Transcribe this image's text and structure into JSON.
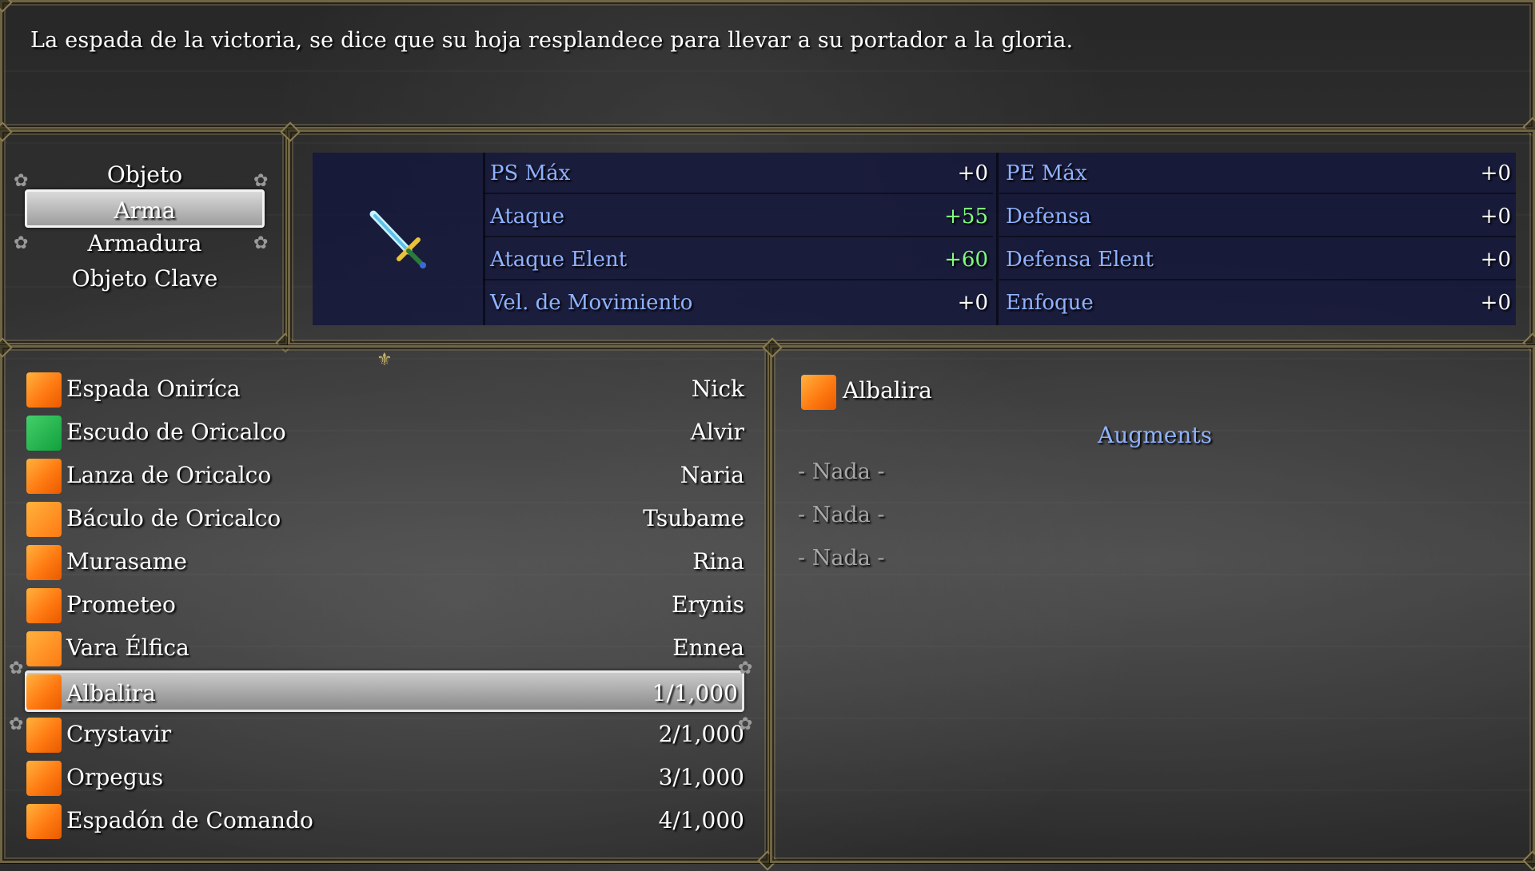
{
  "help": {
    "text": "La espada de la victoria, se dice que su hoja resplandece para llevar a su portador a la gloria."
  },
  "categories": [
    {
      "label": "Objeto"
    },
    {
      "label": "Arma",
      "selected": true
    },
    {
      "label": "Armadura"
    },
    {
      "label": "Objeto Clave"
    }
  ],
  "stats": {
    "weapon_icon": "sword-icon",
    "left": [
      {
        "name": "PS Máx",
        "value": "+0",
        "changed": false
      },
      {
        "name": "Ataque",
        "value": "+55",
        "changed": true
      },
      {
        "name": "Ataque Elent",
        "value": "+60",
        "changed": true
      },
      {
        "name": "Vel. de Movimiento",
        "value": "+0",
        "changed": false
      }
    ],
    "right": [
      {
        "name": "PE Máx",
        "value": "+0",
        "changed": false
      },
      {
        "name": "Defensa",
        "value": "+0",
        "changed": false
      },
      {
        "name": "Defensa Elent",
        "value": "+0",
        "changed": false
      },
      {
        "name": "Enfoque",
        "value": "+0",
        "changed": false
      }
    ],
    "colors": {
      "label": "#8fb2ff",
      "increase": "#7fff7f",
      "neutral": "#ffffff"
    }
  },
  "items": [
    {
      "name": "Espada Oniríca",
      "owner": "Nick",
      "icon": "sword-icon"
    },
    {
      "name": "Escudo de Oricalco",
      "owner": "Alvir",
      "icon": "shield-icon"
    },
    {
      "name": "Lanza de Oricalco",
      "owner": "Naria",
      "icon": "spear-icon"
    },
    {
      "name": "Báculo de Oricalco",
      "owner": "Tsubame",
      "icon": "staff-icon"
    },
    {
      "name": "Murasame",
      "owner": "Rina",
      "icon": "katana-icon"
    },
    {
      "name": "Prometeo",
      "owner": "Erynis",
      "icon": "dagger-icon"
    },
    {
      "name": "Vara Élfica",
      "owner": "Ennea",
      "icon": "staff-icon"
    },
    {
      "name": "Albalira",
      "owner": "1/1,000",
      "icon": "sword-icon",
      "selected": true
    },
    {
      "name": "Crystavir",
      "owner": "2/1,000",
      "icon": "sword-icon"
    },
    {
      "name": "Orpegus",
      "owner": "3/1,000",
      "icon": "dagger-icon"
    },
    {
      "name": "Espadón de Comando",
      "owner": "4/1,000",
      "icon": "sword-icon"
    }
  ],
  "detail": {
    "name": "Albalira",
    "icon": "sword-icon",
    "augments_title": "Augments",
    "augment_slots": [
      "- Nada -",
      "- Nada -",
      "- Nada -"
    ]
  }
}
